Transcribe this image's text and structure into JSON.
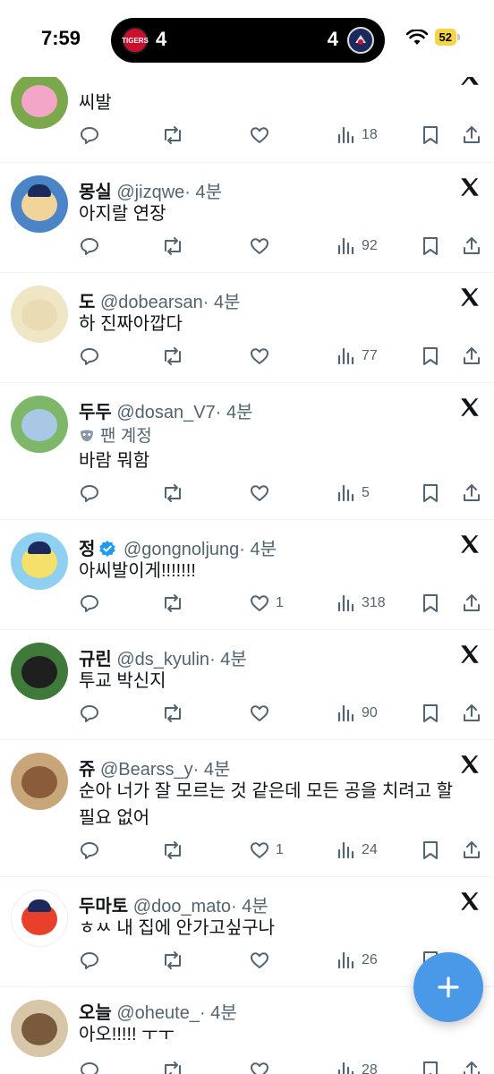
{
  "status_bar": {
    "time": "7:59",
    "score_left": "4",
    "score_right": "4",
    "team_left_logo": "TIGERS",
    "battery": "52"
  },
  "tweets": [
    {
      "name": "",
      "handle": "",
      "time": "",
      "text": "씨발",
      "views": "18",
      "likes": "",
      "avatar_color": "#7aa84a",
      "face_color": "#f4a6c8"
    },
    {
      "name": "몽실",
      "handle": "@jizqwe",
      "time": "· 4분",
      "text": "아지랄 연장",
      "views": "92",
      "likes": "",
      "avatar_color": "#4c84c8",
      "face_color": "#f0d49a"
    },
    {
      "name": "도",
      "handle": "@dobearsan",
      "time": "· 4분",
      "text": "하 진짜아깝다",
      "views": "77",
      "likes": "",
      "avatar_color": "#efe6c6",
      "face_color": "#e9dcb2"
    },
    {
      "name": "두두",
      "handle": "@dosan_V7",
      "time": "· 4분",
      "fan_label": "팬 계정",
      "text": "바람 뭐함",
      "views": "5",
      "likes": "",
      "avatar_color": "#7fb76a",
      "face_color": "#a9c8e6"
    },
    {
      "name": "정",
      "handle": "@gongnoljung",
      "time": "· 4분",
      "text": "아씨발이게!!!!!!!",
      "views": "318",
      "likes": "1",
      "avatar_color": "#8fd0f2",
      "face_color": "#f4e06a"
    },
    {
      "name": "규린",
      "handle": "@ds_kyulin",
      "time": "· 4분",
      "text": "투교 박신지",
      "views": "90",
      "likes": "",
      "avatar_color": "#3f7a3a",
      "face_color": "#1f1f1f"
    },
    {
      "name": "쥬",
      "handle": "@Bearss_y",
      "time": "· 4분",
      "text": "순아 너가 잘 모르는 것 같은데 모든 공을 치려고 할 필요 없어",
      "views": "24",
      "likes": "1",
      "avatar_color": "#c9a57a",
      "face_color": "#8a5c3a"
    },
    {
      "name": "두마토",
      "handle": "@doo_mato",
      "time": "· 4분",
      "text": "ㅎㅆ 내 집에 안가고싶구나",
      "views": "26",
      "likes": "",
      "avatar_color": "#ffffff",
      "face_color": "#e8402a"
    },
    {
      "name": "오늘",
      "handle": "@oheute_",
      "time": "· 4분",
      "text": "아오!!!!! ㅜㅜ",
      "views": "28",
      "likes": "",
      "avatar_color": "#d7c7a8",
      "face_color": "#7a5a3c"
    }
  ],
  "fab": {
    "icon": "plus-icon"
  },
  "colors": {
    "accent": "#1d9bf0",
    "fab": "#4a99e9",
    "muted": "#536471"
  }
}
